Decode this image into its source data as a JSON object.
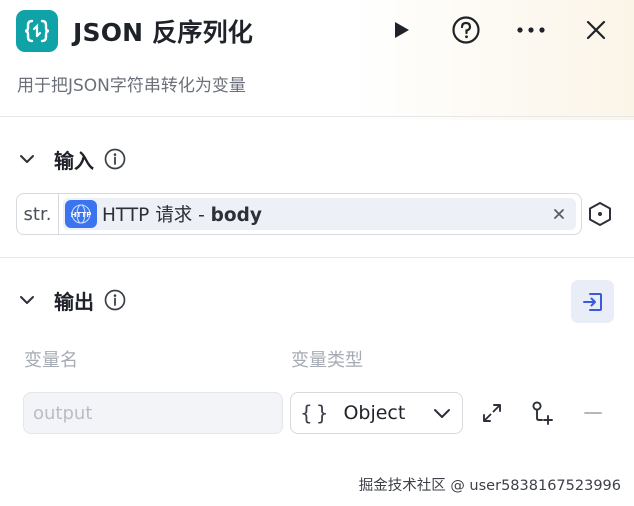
{
  "header": {
    "title": "JSON 反序列化",
    "subtitle": "用于把JSON字符串转化为变量",
    "icon": "json-braces-icon",
    "accent_color": "#0fa3a8"
  },
  "input_section": {
    "title": "输入",
    "param": {
      "type_tag": "str.",
      "source_icon_label": "HTTP",
      "source_name": "HTTP 请求",
      "separator": " - ",
      "field": "body"
    }
  },
  "output_section": {
    "title": "输出",
    "columns": {
      "name": "变量名",
      "type": "变量类型"
    },
    "row": {
      "name_placeholder": "output",
      "type_value": "Object"
    }
  },
  "watermark": "掘金技术社区 @ user5838167523996"
}
